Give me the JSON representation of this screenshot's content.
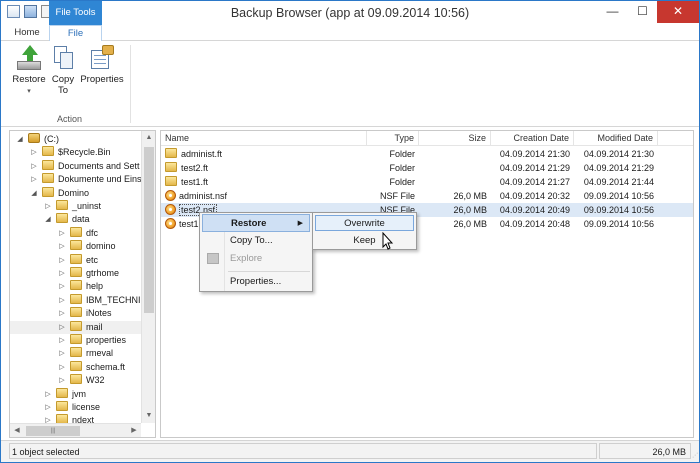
{
  "window": {
    "title": "Backup Browser (app at 09.09.2014 10:56)",
    "controls": {
      "minimize": "—",
      "maximize": "☐",
      "close": "✕"
    }
  },
  "ribbon": {
    "contextual_header": "File Tools",
    "tabs": [
      {
        "label": "Home"
      },
      {
        "label": "File"
      }
    ],
    "buttons": {
      "restore": "Restore",
      "restore_caret": "▾",
      "copy_to_line1": "Copy",
      "copy_to_line2": "To",
      "properties": "Properties"
    },
    "group_label": "Action"
  },
  "tree": {
    "items": [
      {
        "label": "(C:)",
        "expander": "◢",
        "icon": "drive-icon",
        "depth": 0
      },
      {
        "label": "$Recycle.Bin",
        "expander": "▷",
        "depth": 1
      },
      {
        "label": "Documents and Sett",
        "expander": "▷",
        "depth": 1
      },
      {
        "label": "Dokumente und Eins",
        "expander": "▷",
        "depth": 1
      },
      {
        "label": "Domino",
        "expander": "◢",
        "depth": 1
      },
      {
        "label": "_uninst",
        "expander": "▷",
        "depth": 2
      },
      {
        "label": "data",
        "expander": "◢",
        "depth": 2
      },
      {
        "label": "dfc",
        "expander": "▷",
        "depth": 3
      },
      {
        "label": "domino",
        "expander": "▷",
        "depth": 3
      },
      {
        "label": "etc",
        "expander": "▷",
        "depth": 3
      },
      {
        "label": "gtrhome",
        "expander": "▷",
        "depth": 3
      },
      {
        "label": "help",
        "expander": "▷",
        "depth": 3
      },
      {
        "label": "IBM_TECHNI",
        "expander": "▷",
        "depth": 3
      },
      {
        "label": "iNotes",
        "expander": "▷",
        "depth": 3
      },
      {
        "label": "mail",
        "expander": "▷",
        "depth": 3,
        "selected": true
      },
      {
        "label": "properties",
        "expander": "▷",
        "depth": 3
      },
      {
        "label": "rmeval",
        "expander": "▷",
        "depth": 3
      },
      {
        "label": "schema.ft",
        "expander": "▷",
        "depth": 3
      },
      {
        "label": "W32",
        "expander": "▷",
        "depth": 3
      },
      {
        "label": "jvm",
        "expander": "▷",
        "depth": 2
      },
      {
        "label": "license",
        "expander": "▷",
        "depth": 2
      },
      {
        "label": "ndext",
        "expander": "▷",
        "depth": 2
      }
    ],
    "scroll": {
      "up": "▲",
      "down": "▼",
      "left": "◀",
      "right": "▶",
      "thumb_grip": "|||"
    }
  },
  "list": {
    "columns": {
      "name": "Name",
      "type": "Type",
      "size": "Size",
      "created": "Creation Date",
      "modified": "Modified Date"
    },
    "rows": [
      {
        "name": "administ.ft",
        "type": "Folder",
        "size": "",
        "created": "04.09.2014 21:30",
        "modified": "04.09.2014 21:30",
        "icon": "folder-icon"
      },
      {
        "name": "test2.ft",
        "type": "Folder",
        "size": "",
        "created": "04.09.2014 21:29",
        "modified": "04.09.2014 21:29",
        "icon": "folder-icon"
      },
      {
        "name": "test1.ft",
        "type": "Folder",
        "size": "",
        "created": "04.09.2014 21:27",
        "modified": "04.09.2014 21:44",
        "icon": "folder-icon"
      },
      {
        "name": "administ.nsf",
        "type": "NSF File",
        "size": "26,0 MB",
        "created": "04.09.2014 20:32",
        "modified": "09.09.2014 10:56",
        "icon": "nsf-icon"
      },
      {
        "name": "test2.nsf",
        "type": "NSF File",
        "size": "26,0 MB",
        "created": "04.09.2014 20:49",
        "modified": "09.09.2014 10:56",
        "icon": "nsf-icon",
        "selected": true
      },
      {
        "name": "test1",
        "type": "NSF File",
        "size": "26,0 MB",
        "created": "04.09.2014 20:48",
        "modified": "09.09.2014 10:56",
        "icon": "nsf-icon"
      }
    ]
  },
  "context_menu": {
    "items": [
      {
        "label": "Restore",
        "has_submenu": true,
        "submenu_arrow": "▶"
      },
      {
        "label": "Copy To..."
      },
      {
        "label": "Explore",
        "disabled": true
      },
      {
        "label": "Properties..."
      }
    ],
    "submenu": [
      {
        "label": "Overwrite"
      },
      {
        "label": "Keep"
      }
    ]
  },
  "status": {
    "left": "1 object selected",
    "right": "26,0 MB",
    "grip": "⋰"
  }
}
